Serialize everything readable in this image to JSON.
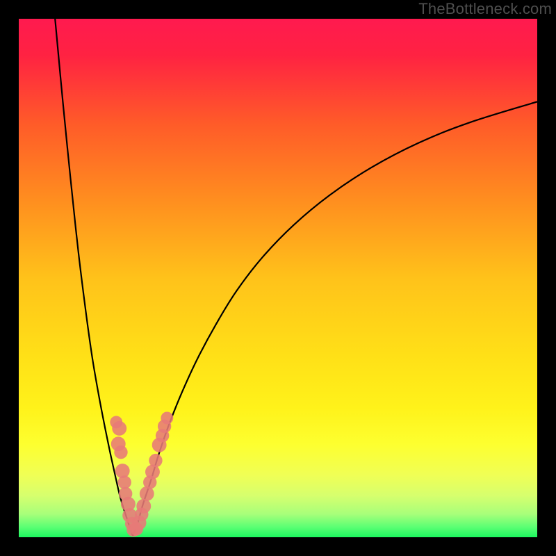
{
  "watermark": "TheBottleneck.com",
  "chart_data": {
    "type": "line",
    "title": "",
    "xlabel": "",
    "ylabel": "",
    "xlim": [
      0,
      100
    ],
    "ylim": [
      0,
      100
    ],
    "grid": false,
    "legend": false,
    "gradient_stops": [
      {
        "pos": 0.0,
        "color": "#ff1a4f"
      },
      {
        "pos": 0.07,
        "color": "#ff2242"
      },
      {
        "pos": 0.2,
        "color": "#ff5a29"
      },
      {
        "pos": 0.35,
        "color": "#ff8e1f"
      },
      {
        "pos": 0.5,
        "color": "#ffc21a"
      },
      {
        "pos": 0.65,
        "color": "#ffe017"
      },
      {
        "pos": 0.75,
        "color": "#fff21a"
      },
      {
        "pos": 0.82,
        "color": "#fdff2f"
      },
      {
        "pos": 0.88,
        "color": "#f0ff55"
      },
      {
        "pos": 0.92,
        "color": "#d6ff6e"
      },
      {
        "pos": 0.955,
        "color": "#a8ff7a"
      },
      {
        "pos": 0.98,
        "color": "#5cff74"
      },
      {
        "pos": 1.0,
        "color": "#1cf75f"
      }
    ],
    "series": [
      {
        "name": "left-branch",
        "x": [
          7.0,
          8.5,
          10.0,
          11.5,
          13.0,
          14.2,
          15.5,
          16.7,
          17.8,
          18.8,
          19.5,
          20.3,
          21.0,
          21.5,
          22.0
        ],
        "y": [
          100.0,
          84.0,
          69.0,
          55.0,
          43.0,
          34.5,
          27.0,
          20.8,
          15.5,
          11.0,
          8.0,
          5.3,
          3.2,
          1.6,
          0.3
        ]
      },
      {
        "name": "right-branch",
        "x": [
          22.0,
          23.0,
          24.0,
          25.5,
          27.0,
          29.0,
          31.5,
          34.5,
          38.0,
          42.0,
          47.0,
          53.0,
          60.0,
          68.0,
          77.0,
          87.0,
          100.0
        ],
        "y": [
          0.3,
          3.0,
          6.5,
          11.0,
          16.0,
          21.8,
          28.0,
          34.5,
          41.0,
          47.5,
          54.0,
          60.2,
          66.0,
          71.3,
          76.0,
          80.0,
          84.0
        ]
      }
    ],
    "marker_clusters": [
      {
        "name": "left-cluster",
        "color": "#e77a77",
        "points": [
          {
            "x": 18.8,
            "y": 22.2,
            "r": 1.2
          },
          {
            "x": 19.4,
            "y": 21.0,
            "r": 1.4
          },
          {
            "x": 19.2,
            "y": 18.0,
            "r": 1.4
          },
          {
            "x": 19.7,
            "y": 16.4,
            "r": 1.3
          },
          {
            "x": 20.0,
            "y": 12.8,
            "r": 1.4
          },
          {
            "x": 20.4,
            "y": 10.6,
            "r": 1.3
          },
          {
            "x": 20.6,
            "y": 8.4,
            "r": 1.3
          },
          {
            "x": 21.1,
            "y": 6.4,
            "r": 1.4
          },
          {
            "x": 21.4,
            "y": 4.2,
            "r": 1.4
          },
          {
            "x": 21.8,
            "y": 2.6,
            "r": 1.3
          },
          {
            "x": 22.1,
            "y": 1.4,
            "r": 1.3
          }
        ]
      },
      {
        "name": "right-cluster",
        "color": "#e77a77",
        "points": [
          {
            "x": 22.7,
            "y": 1.6,
            "r": 1.3
          },
          {
            "x": 23.2,
            "y": 2.8,
            "r": 1.4
          },
          {
            "x": 23.7,
            "y": 4.4,
            "r": 1.3
          },
          {
            "x": 24.1,
            "y": 6.0,
            "r": 1.4
          },
          {
            "x": 24.7,
            "y": 8.4,
            "r": 1.4
          },
          {
            "x": 25.3,
            "y": 10.6,
            "r": 1.3
          },
          {
            "x": 25.8,
            "y": 12.6,
            "r": 1.4
          },
          {
            "x": 26.4,
            "y": 14.8,
            "r": 1.3
          },
          {
            "x": 27.1,
            "y": 17.8,
            "r": 1.4
          },
          {
            "x": 27.7,
            "y": 19.6,
            "r": 1.3
          },
          {
            "x": 28.1,
            "y": 21.4,
            "r": 1.3
          },
          {
            "x": 28.6,
            "y": 23.0,
            "r": 1.2
          }
        ]
      }
    ]
  }
}
